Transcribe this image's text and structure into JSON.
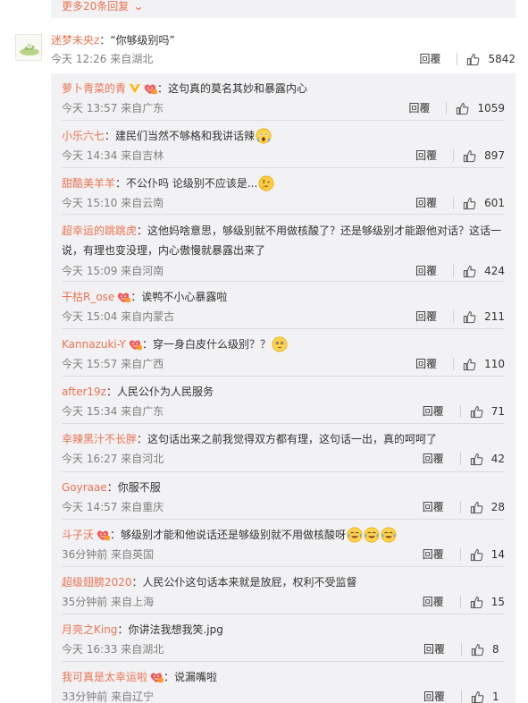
{
  "top": {
    "more_replies": "更多20条回复"
  },
  "main_comment": {
    "username": "迷梦未央z",
    "text": "：“你够级别吗”",
    "time": "今天 12:26",
    "location": "来自湖北",
    "reply_label": "回覆",
    "likes": "5842"
  },
  "replies": [
    {
      "username": "萝卜青菜的青",
      "vip": true,
      "badge": true,
      "text": "：这句真的莫名其妙和暴露内心",
      "time": "今天 13:57",
      "location": "来自广东",
      "reply_label": "回覆",
      "likes": "1059"
    },
    {
      "username": "小乐六七",
      "badge": false,
      "text": "：建民们当然不够格和我讲话辣",
      "emojis": [
        "face-scream-emoji"
      ],
      "time": "今天 14:34",
      "location": "来自吉林",
      "reply_label": "回覆",
      "likes": "897"
    },
    {
      "username": "甜酷美羊羊",
      "badge": false,
      "text": "：不公仆吗 论级别不应该是...",
      "emojis": [
        "thinking-emoji"
      ],
      "time": "今天 15:10",
      "location": "来自云南",
      "reply_label": "回覆",
      "likes": "601"
    },
    {
      "username": "超幸运的跳跳虎",
      "badge": false,
      "text": "：这他妈啥意思，够级别就不用做核酸了？还是够级别才能跟他对话？这话一",
      "text2": "说，有理也变没理，内心傲慢就暴露出来了",
      "time": "今天 15:09",
      "location": "来自河南",
      "reply_label": "回覆",
      "likes": "424"
    },
    {
      "username": "干枯R_ose",
      "badge": true,
      "text": "：诶鸭不小心暴露啦",
      "time": "今天 15:04",
      "location": "来自内蒙古",
      "reply_label": "回覆",
      "likes": "211"
    },
    {
      "username": "Kannazuki-Y",
      "badge": true,
      "text": "：穿一身白皮什么级别？？",
      "emojis": [
        "speechless-emoji"
      ],
      "time": "今天 15:57",
      "location": "来自广西",
      "reply_label": "回覆",
      "likes": "110"
    },
    {
      "username": "after19z",
      "badge": false,
      "text": "：人民公仆为人民服务",
      "time": "今天 15:34",
      "location": "来自广东",
      "reply_label": "回覆",
      "likes": "71"
    },
    {
      "username": "幸辣黑汁不长胖",
      "badge": false,
      "text": "：这句话出来之前我觉得双方都有理，这句话一出，真的呵呵了",
      "time": "今天 16:27",
      "location": "来自河北",
      "reply_label": "回覆",
      "likes": "42"
    },
    {
      "username": "Goyraae",
      "badge": false,
      "text": "：你服不服",
      "time": "今天 14:57",
      "location": "来自重庆",
      "reply_label": "回覆",
      "likes": "28"
    },
    {
      "username": "斗子沃",
      "badge": true,
      "text": "：够级别才能和他说话还是够级别就不用做核酸呀",
      "emojis": [
        "laugh-cry-emoji",
        "laugh-cry-emoji",
        "laugh-cry-emoji"
      ],
      "time": "36分钟前",
      "location": "来自英国",
      "reply_label": "回覆",
      "likes": "14"
    },
    {
      "username": "超级翅膀2020",
      "badge": false,
      "text": "：人民公仆这句话本来就是放屁，权利不受监督",
      "time": "35分钟前",
      "location": "来自上海",
      "reply_label": "回覆",
      "likes": "15"
    },
    {
      "username": "月亮之King",
      "badge": false,
      "text": "：你讲法我想我笑.jpg",
      "time": "今天 16:33",
      "location": "来自湖北",
      "reply_label": "回覆",
      "likes": "8"
    },
    {
      "username": "我可真是太幸运啦",
      "badge": true,
      "text": "：说漏嘴啦",
      "time": "33分钟前",
      "location": "来自辽宁",
      "reply_label": "回覆",
      "likes": "1"
    }
  ],
  "colors": {
    "username": "#eb7350",
    "panel": "#f2f2f5",
    "meta": "#808080"
  }
}
